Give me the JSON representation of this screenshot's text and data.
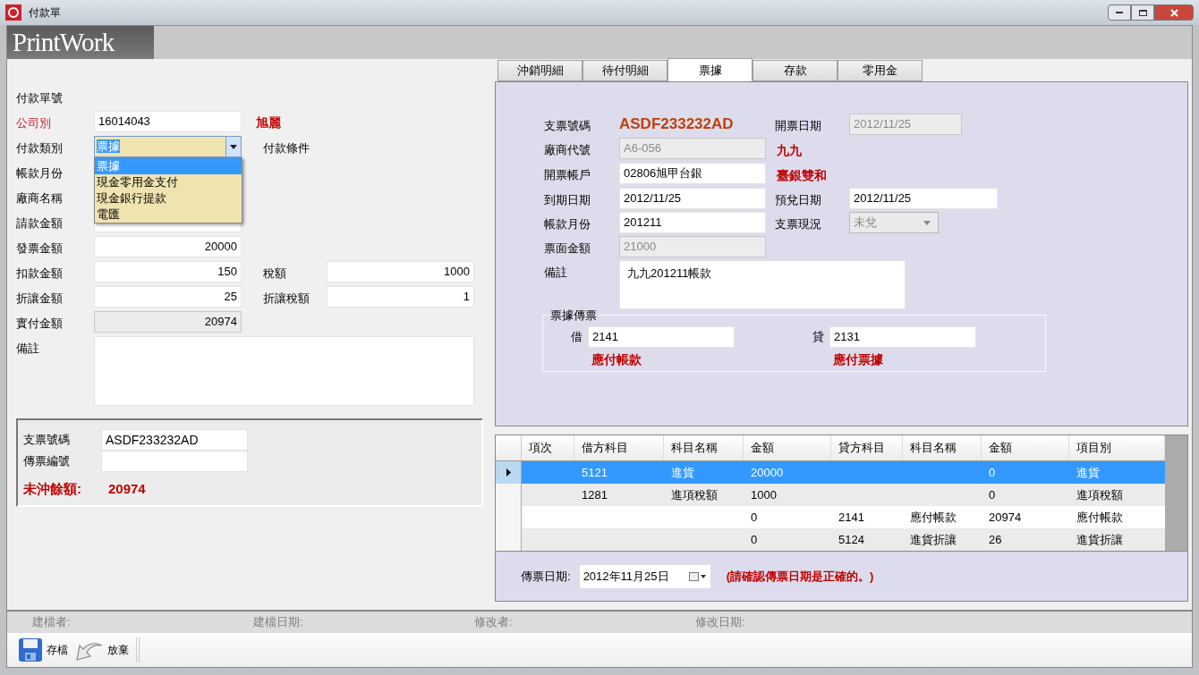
{
  "window": {
    "title": "付款單"
  },
  "logo": "PrintWork",
  "form": {
    "rows": [
      {
        "label": "付款單號",
        "required": false
      },
      {
        "label": "公司別",
        "required": true,
        "field": {
          "kind": "input",
          "value": "16014043"
        },
        "note": "旭麗"
      },
      {
        "label": "付款類別",
        "required": false,
        "field": {
          "kind": "combo",
          "value": "票據"
        },
        "side_label": "付款條件"
      },
      {
        "label": "帳款月份",
        "required": false
      },
      {
        "label": "廠商名稱",
        "required": false
      },
      {
        "label": "請款金額",
        "required": false,
        "field": {
          "kind": "amount"
        }
      },
      {
        "label": "發票金額",
        "required": false,
        "field": {
          "kind": "amount",
          "value": "20000"
        }
      },
      {
        "label": "扣款金額",
        "required": false,
        "field": {
          "kind": "amount",
          "value": "150"
        },
        "side": {
          "label": "稅額",
          "value": "1000"
        }
      },
      {
        "label": "折讓金額",
        "required": false,
        "field": {
          "kind": "amount",
          "value": "25"
        },
        "side": {
          "label": "折讓稅額",
          "value": "1"
        }
      },
      {
        "label": "實付金額",
        "required": false,
        "field": {
          "kind": "readonly",
          "value": "20974"
        }
      },
      {
        "label": "備註",
        "required": false,
        "field": {
          "kind": "memo"
        }
      }
    ],
    "dropdown": {
      "open": true,
      "options": [
        {
          "label": "票據",
          "selected": true
        },
        {
          "label": "現金零用金支付",
          "selected": false
        },
        {
          "label": "現金銀行提款",
          "selected": false
        },
        {
          "label": "電匯",
          "selected": false
        }
      ]
    }
  },
  "cheque_box": {
    "fields": [
      {
        "label": "支票號碼",
        "value": "ASDF233232AD"
      },
      {
        "label": "傳票編號"
      }
    ],
    "balance_label": "未沖餘額:",
    "balance": "20974"
  },
  "tabs": [
    {
      "label": "沖銷明細",
      "selected": false
    },
    {
      "label": "待付明細",
      "selected": false
    },
    {
      "label": "票據",
      "selected": true
    },
    {
      "label": "存款",
      "selected": false
    },
    {
      "label": "零用金",
      "selected": false
    }
  ],
  "cheque": {
    "rows": [
      {
        "label": "支票號碼",
        "field": {
          "kind": "display",
          "value": "ASDF233232AD"
        },
        "right": {
          "label": "開票日期",
          "field": {
            "kind": "readonly",
            "value": "2012/11/25"
          }
        }
      },
      {
        "label": "廠商代號",
        "field": {
          "kind": "readonly",
          "value": "A6-056"
        },
        "note": "九九"
      },
      {
        "label": "開票帳戶",
        "field": {
          "kind": "input",
          "value": "02806旭甲台銀"
        },
        "note": "臺銀雙和"
      },
      {
        "label": "到期日期",
        "field": {
          "kind": "input",
          "value": "2012/11/25"
        },
        "right": {
          "label": "預兌日期",
          "field": {
            "kind": "input",
            "value": "2012/11/25"
          }
        }
      },
      {
        "label": "帳款月份",
        "field": {
          "kind": "input",
          "value": "201211"
        },
        "right": {
          "label": "支票現況",
          "field": {
            "kind": "combo",
            "value": "未兌"
          }
        }
      },
      {
        "label": "票面金額",
        "field": {
          "kind": "readonly",
          "value": "21000"
        }
      },
      {
        "label": "備註",
        "field": {
          "kind": "memo",
          "value": "九九201211帳款"
        }
      }
    ],
    "voucher": {
      "title": "票據傳票",
      "entries": [
        {
          "label": "借",
          "value": "2141",
          "name": "應付帳款"
        },
        {
          "label": "貸",
          "value": "2131",
          "name": "應付票據"
        }
      ]
    }
  },
  "table": {
    "columns": [
      "項次",
      "借方科目",
      "科目名稱",
      "金額",
      "貸方科目",
      "科目名稱",
      "金額",
      "項目別"
    ],
    "rows": [
      {
        "selected": true,
        "cells": [
          null,
          "5121",
          "進貨",
          "20000",
          null,
          null,
          "0",
          "進貨"
        ]
      },
      {
        "selected": false,
        "cells": [
          null,
          "1281",
          "進項稅額",
          "1000",
          null,
          null,
          "0",
          "進項稅額"
        ]
      },
      {
        "selected": false,
        "cells": [
          null,
          null,
          null,
          "0",
          "2141",
          "應付帳款",
          "20974",
          "應付帳款"
        ]
      },
      {
        "selected": false,
        "cells": [
          null,
          null,
          null,
          "0",
          "5124",
          "進貨折讓",
          "26",
          "進貨折讓"
        ]
      }
    ]
  },
  "voucher_date": {
    "label": "傳票日期:",
    "value": "2012年11月25日",
    "warning": "(請確認傳票日期是正確的。)"
  },
  "status_bar": [
    "建檔者:",
    "建檔日期:",
    "修改者:",
    "修改日期:"
  ],
  "toolbar": [
    {
      "kind": "save",
      "label": "存檔"
    },
    {
      "kind": "cancel",
      "label": "放棄"
    }
  ]
}
